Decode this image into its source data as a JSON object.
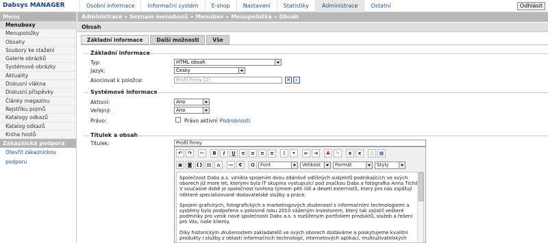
{
  "app": {
    "title": "Dabsys MANAGER",
    "logout": "Odhlásit"
  },
  "menu": [
    "Osobní informace",
    "Informační systém",
    "E-shop",
    "Nastavení",
    "Statistiky",
    "Administrace",
    "Ostatní"
  ],
  "active_menu": "Administrace",
  "sidebar": {
    "header": "Menu",
    "items": [
      "Menuboxy",
      "Menupoložky",
      "Obsahy",
      "Soubory ke stažení",
      "Galerie obrázků",
      "Systémové obrázky",
      "Aktuality",
      "Diskusní vlákna",
      "Diskusní příspěvky",
      "Články magazínu",
      "Rejstříku pojmů",
      "Katalogy odkazů",
      "Katalog odkazů",
      "Kniha hostů"
    ],
    "active_item": "Menuboxy",
    "support_header": "Zákaznická podpora",
    "support_link": "Otevřít zákaznickou podporu"
  },
  "breadcrumb": "Administrace » Seznam menuboxů » Menubox » Menupoložka » Obsah",
  "page_title": "Obsah",
  "tabs": [
    "Základní informace",
    "Další možnosti",
    "Vše"
  ],
  "sections": {
    "basic": {
      "title": "Základní informace",
      "type_label": "Typ:",
      "type_value": "HTML obsah",
      "lang_label": "Jazyk:",
      "lang_value": "Česky",
      "assoc_label": "Asociovat k položce:",
      "assoc_value": "Profil firmy [2]"
    },
    "system": {
      "title": "Systémové informace",
      "active_label": "Aktivní:",
      "active_value": "Ano",
      "public_label": "Veřejný:",
      "public_value": "Ano",
      "rights_label": "Právo:",
      "rights_text": "Právo aktivní -",
      "rights_link": "Podrobnosti"
    },
    "content": {
      "title": "Titulek a obsah",
      "title_label": "Titulek:",
      "title_value": "Profil firmy",
      "font": "Font",
      "size": "Velikost",
      "format": "Formát",
      "styles": "Styly",
      "paragraphs": [
        "Společnost Dabs a.s. vznikla spojením dvou zdánlivě odlišných subjektů podnikajících ve svých oborech již more let, kterými byla IT skupina vystupující pod značkou Dabs a fotografka Anna Tichá. V současné době je společnost tvořena týmem pěti lidí a deseti externistů, který pro nás zajišťují některé specializované dodavatelské služby a práce.",
        "Spojení grafických, fotografických a marketingových zkušeností s informačními technologiemi a systémy bylo podpořeno v polovině roku 2010 váženým investorem, který tak zajistil veškeré podmínky pro vznik nové společnosti Dabs a.s. s rozšířeným portfoliem produktů, služeb a řešení pro Vás, naše klienty.",
        "Díky historickým zkušenostem zakladatelů ve svých oborech dodáváme a poskytujeme kvalitní produkty i služby z oblasti informačních technologií, internetových aplikací, multiuživatelských"
      ]
    }
  }
}
